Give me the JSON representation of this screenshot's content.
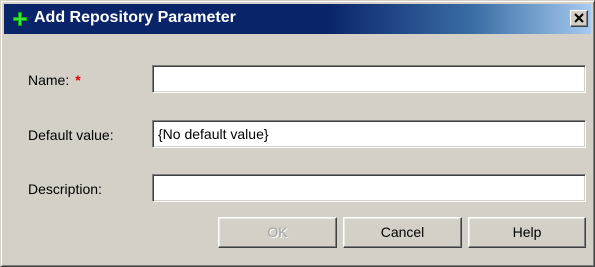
{
  "window": {
    "title": "Add Repository Parameter",
    "close_icon": "close-icon",
    "title_icon": "green-plus-icon"
  },
  "form": {
    "name_label": "Name:",
    "name_required_marker": "*",
    "name_value": "",
    "default_label": "Default value:",
    "default_value": "{No default value}",
    "description_label": "Description:",
    "description_value": ""
  },
  "buttons": {
    "ok_label": "OK",
    "ok_enabled": false,
    "cancel_label": "Cancel",
    "help_label": "Help"
  },
  "colors": {
    "titlebar_active": "#0a246a",
    "required_marker": "#e00000",
    "dialog_face": "#d4d0c8",
    "icon_green": "#00a000"
  }
}
